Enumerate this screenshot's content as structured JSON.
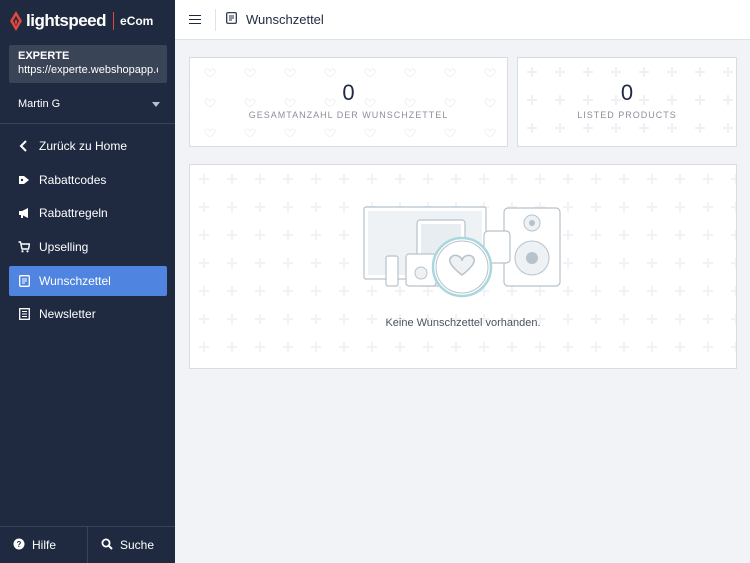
{
  "brand": {
    "name": "lightspeed",
    "product": "eCom",
    "flame_color": "#e0483c"
  },
  "store": {
    "name": "EXPERTE",
    "url": "https://experte.webshopapp.c..."
  },
  "user": {
    "name": "Martin G"
  },
  "nav": [
    {
      "label": "Zurück zu Home",
      "icon": "chevron-left-icon"
    },
    {
      "label": "Rabattcodes",
      "icon": "tag-icon"
    },
    {
      "label": "Rabattregeln",
      "icon": "megaphone-icon"
    },
    {
      "label": "Upselling",
      "icon": "cart-icon"
    },
    {
      "label": "Wunschzettel",
      "icon": "wishlist-icon",
      "active": true
    },
    {
      "label": "Newsletter",
      "icon": "newsletter-icon"
    }
  ],
  "bottom": {
    "help": "Hilfe",
    "search": "Suche"
  },
  "topbar": {
    "title": "Wunschzettel"
  },
  "stats": [
    {
      "value": "0",
      "label": "GESAMTANZAHL DER WUNSCHZETTEL"
    },
    {
      "value": "0",
      "label": "LISTED PRODUCTS"
    }
  ],
  "empty_state": {
    "message": "Keine Wunschzettel vorhanden."
  },
  "colors": {
    "sidebar": "#1f2a40",
    "active": "#4f85e0",
    "background": "#f1f3f6"
  }
}
